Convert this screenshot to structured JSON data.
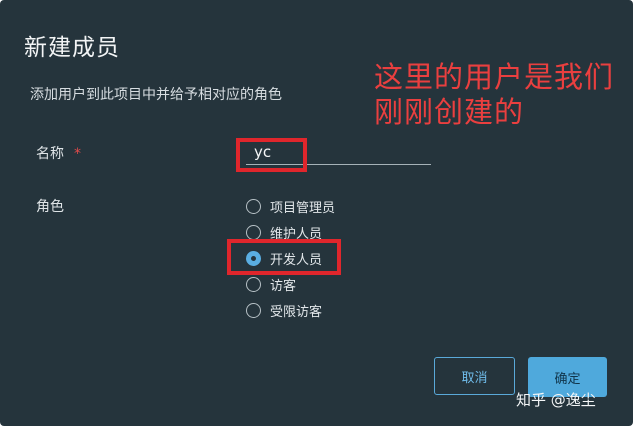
{
  "dialog": {
    "title": "新建成员",
    "description": "添加用户到此项目中并给予相对应的角色"
  },
  "annotation": {
    "text": "这里的用户是我们刚刚创建的",
    "color": "#ea3f3f"
  },
  "form": {
    "name_label": "名称",
    "required_mark": "*",
    "name_value": "yc",
    "role_label": "角色",
    "roles": [
      {
        "label": "项目管理员",
        "checked": false
      },
      {
        "label": "维护人员",
        "checked": false
      },
      {
        "label": "开发人员",
        "checked": true
      },
      {
        "label": "访客",
        "checked": false
      },
      {
        "label": "受限访客",
        "checked": false
      }
    ]
  },
  "buttons": {
    "cancel": "取消",
    "confirm": "确定"
  },
  "watermark": "知乎 @逸尘",
  "colors": {
    "background": "#25343c",
    "accent": "#4fa9dc",
    "highlight": "#e0262c"
  }
}
